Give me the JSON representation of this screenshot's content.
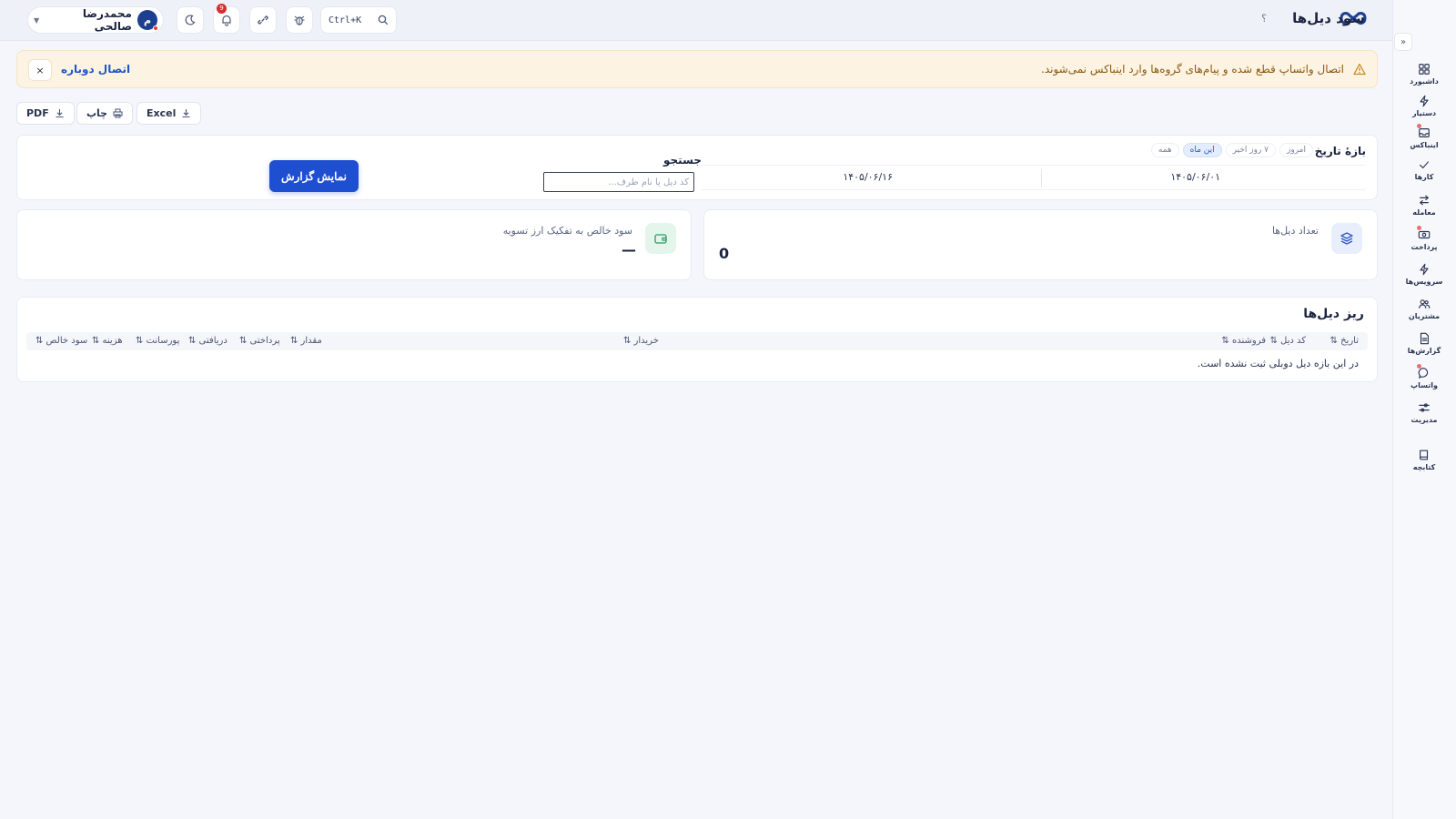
{
  "header": {
    "title": "سود دیل‌ها",
    "help": "؟",
    "search_shortcut": "Ctrl+K",
    "notification_count": "9",
    "user": {
      "name": "محمدرضا صالحی",
      "initial": "م"
    }
  },
  "alert": {
    "message": "اتصال واتساپ قطع شده و پیام‌های گروه‌ها وارد اینباکس نمی‌شوند.",
    "action": "اتصال دوباره",
    "close": "×"
  },
  "export": {
    "excel": "Excel",
    "print": "چاپ",
    "pdf": "PDF"
  },
  "filter": {
    "label": "بازهٔ تاریخ",
    "chips": [
      "امروز",
      "۷ روز اخیر",
      "این ماه",
      "همه"
    ],
    "active_chip": "این ماه",
    "date_from": "۱۴۰۵/۰۶/۰۱",
    "date_to": "۱۴۰۵/۰۶/۱۶",
    "search_label": "جستجو",
    "search_placeholder": "کد دیل یا نام طرف...",
    "submit": "نمایش گزارش"
  },
  "stats": {
    "deal_count": {
      "title": "تعداد دیل‌ها",
      "value": "0"
    },
    "net_profit": {
      "title": "سود خالص به تفکیک ارز تسویه",
      "value": "—"
    }
  },
  "table": {
    "title": "ریز دیل‌ها",
    "columns": [
      "تاریخ ⇅",
      "کد دیل ⇅",
      "فروشنده ⇅",
      "خریدار ⇅",
      "مقدار ⇅",
      "پرداختی ⇅",
      "دریافتی ⇅",
      "پورسانت ⇅",
      "هزینه ⇅",
      "سود خالص ⇅"
    ],
    "empty": "در این بازه دیل دوبلی ثبت نشده است."
  },
  "nav": [
    {
      "label": "داشبورد",
      "icon": "grid-icon"
    },
    {
      "label": "دستیار",
      "icon": "bolt-icon"
    },
    {
      "label": "اینباکس",
      "icon": "inbox-icon",
      "dot": true
    },
    {
      "label": "کارها",
      "icon": "check-icon"
    },
    {
      "label": "معامله",
      "icon": "swap-icon"
    },
    {
      "label": "پرداخت",
      "icon": "cash-icon",
      "dot": true
    },
    {
      "label": "سرویس‌ها",
      "icon": "bolt-icon"
    },
    {
      "label": "مشتریان",
      "icon": "users-icon"
    },
    {
      "label": "گزارش‌ها",
      "icon": "report-icon"
    },
    {
      "label": "واتساپ",
      "icon": "chat-icon",
      "dot": true
    },
    {
      "label": "مدیریت",
      "icon": "sliders-icon"
    },
    {
      "label": "کتابچه",
      "icon": "book-icon"
    }
  ],
  "colors": {
    "primary": "#1f4fd1",
    "alert_bg": "#fdf3e3",
    "alert_text": "#8a5a12",
    "badge": "#d32f2f"
  }
}
